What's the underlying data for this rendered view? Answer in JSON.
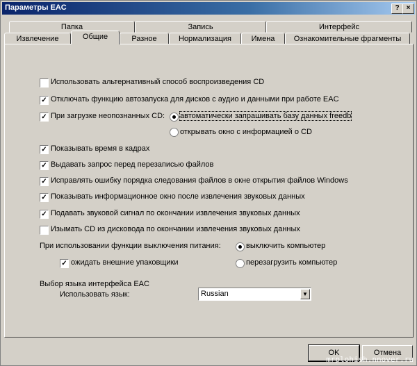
{
  "window": {
    "title": "Параметры EAC",
    "help_btn": "?",
    "close_btn": "×"
  },
  "tabs_row1": [
    "Папка",
    "Запись",
    "Интерфейс"
  ],
  "tabs_row2": [
    "Извлечение",
    "Общие",
    "Разное",
    "Нормализация",
    "Имена",
    "Ознакомительные фрагменты"
  ],
  "active_tab": "Общие",
  "options": [
    {
      "label": "Использовать альтернативный способ воспроизведения CD",
      "checked": false
    },
    {
      "label": "Отключать функцию автозапуска для дисков с аудио и данными при работе EAC",
      "checked": true
    },
    {
      "label": "При загрузке неопознанных CD:",
      "checked": true
    },
    {
      "label": "Показывать время в кадрах",
      "checked": true
    },
    {
      "label": "Выдавать запрос перед перезаписью файлов",
      "checked": true
    },
    {
      "label": "Исправлять ошибку порядка следования файлов в окне открытия файлов Windows",
      "checked": true
    },
    {
      "label": "Показывать информационное окно после извлечения звуковых данных",
      "checked": true
    },
    {
      "label": "Подавать звуковой сигнал по окончании извлечения звуковых данных",
      "checked": true
    },
    {
      "label": "Изымать CD из дисковода по окончании извлечения звуковых данных",
      "checked": false
    }
  ],
  "unknown_cd": {
    "radio1": "автоматически запрашивать базу данных freedb",
    "radio2": "открывать окно с информацией о CD",
    "selected": 1
  },
  "power": {
    "label": "При использовании функции выключения питания:",
    "radio1": "выключить компьютер",
    "radio2": "перезагрузить компьютер",
    "selected": 1,
    "wait_label": "ожидать внешние упаковщики",
    "wait_checked": true
  },
  "language": {
    "section": "Выбор языка интерфейса EAC",
    "label": "Использовать язык:",
    "value": "Russian"
  },
  "buttons": {
    "ok": "OK",
    "cancel": "Отмена"
  },
  "watermark": "mrplohish.nnover.ru"
}
